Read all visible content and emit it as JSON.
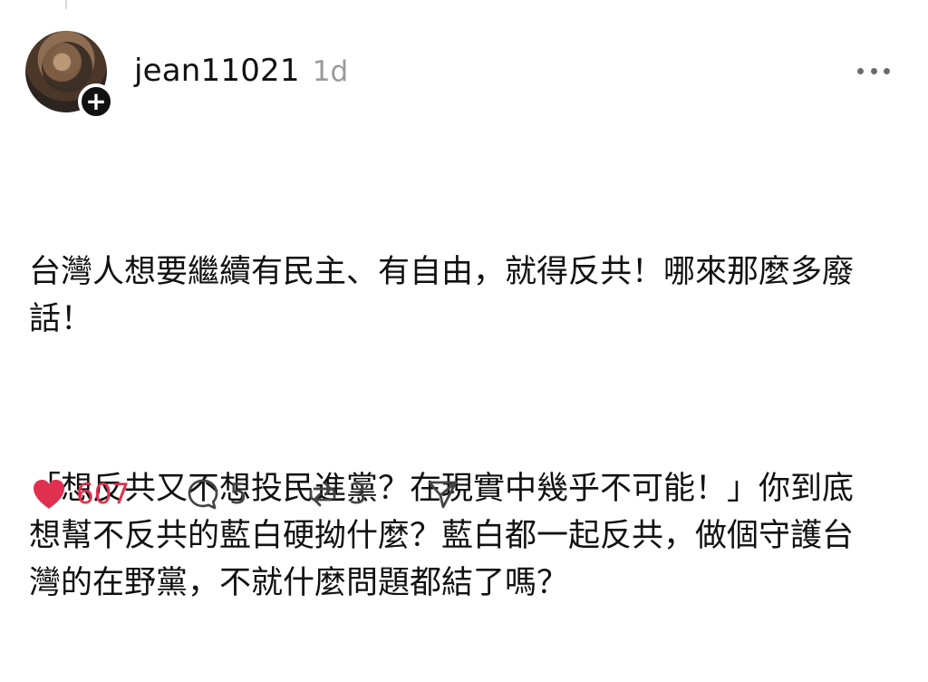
{
  "post": {
    "author": {
      "username": "jean11021",
      "time": "1d"
    },
    "icons": {
      "avatar": "avatar",
      "follow": "plus-icon",
      "more": "more-horizontal-icon"
    },
    "body": {
      "paragraphs": [
        "台灣人想要繼續有民主、有自由，就得反共！哪來那麼多廢話！",
        "「想反共又不想投民進黨？在現實中幾乎不可能！」你到底想幫不反共的藍白硬拗什麼？藍白都一起反共，做個守護台灣的在野黨，不就什麼問題都結了嗎？"
      ]
    },
    "actions": {
      "likes": "607",
      "comments": "5",
      "reposts": "3",
      "share_icon": "send-icon"
    },
    "colors": {
      "like": "#e0304f",
      "text": "#111111",
      "muted": "#9a9a9a"
    }
  }
}
